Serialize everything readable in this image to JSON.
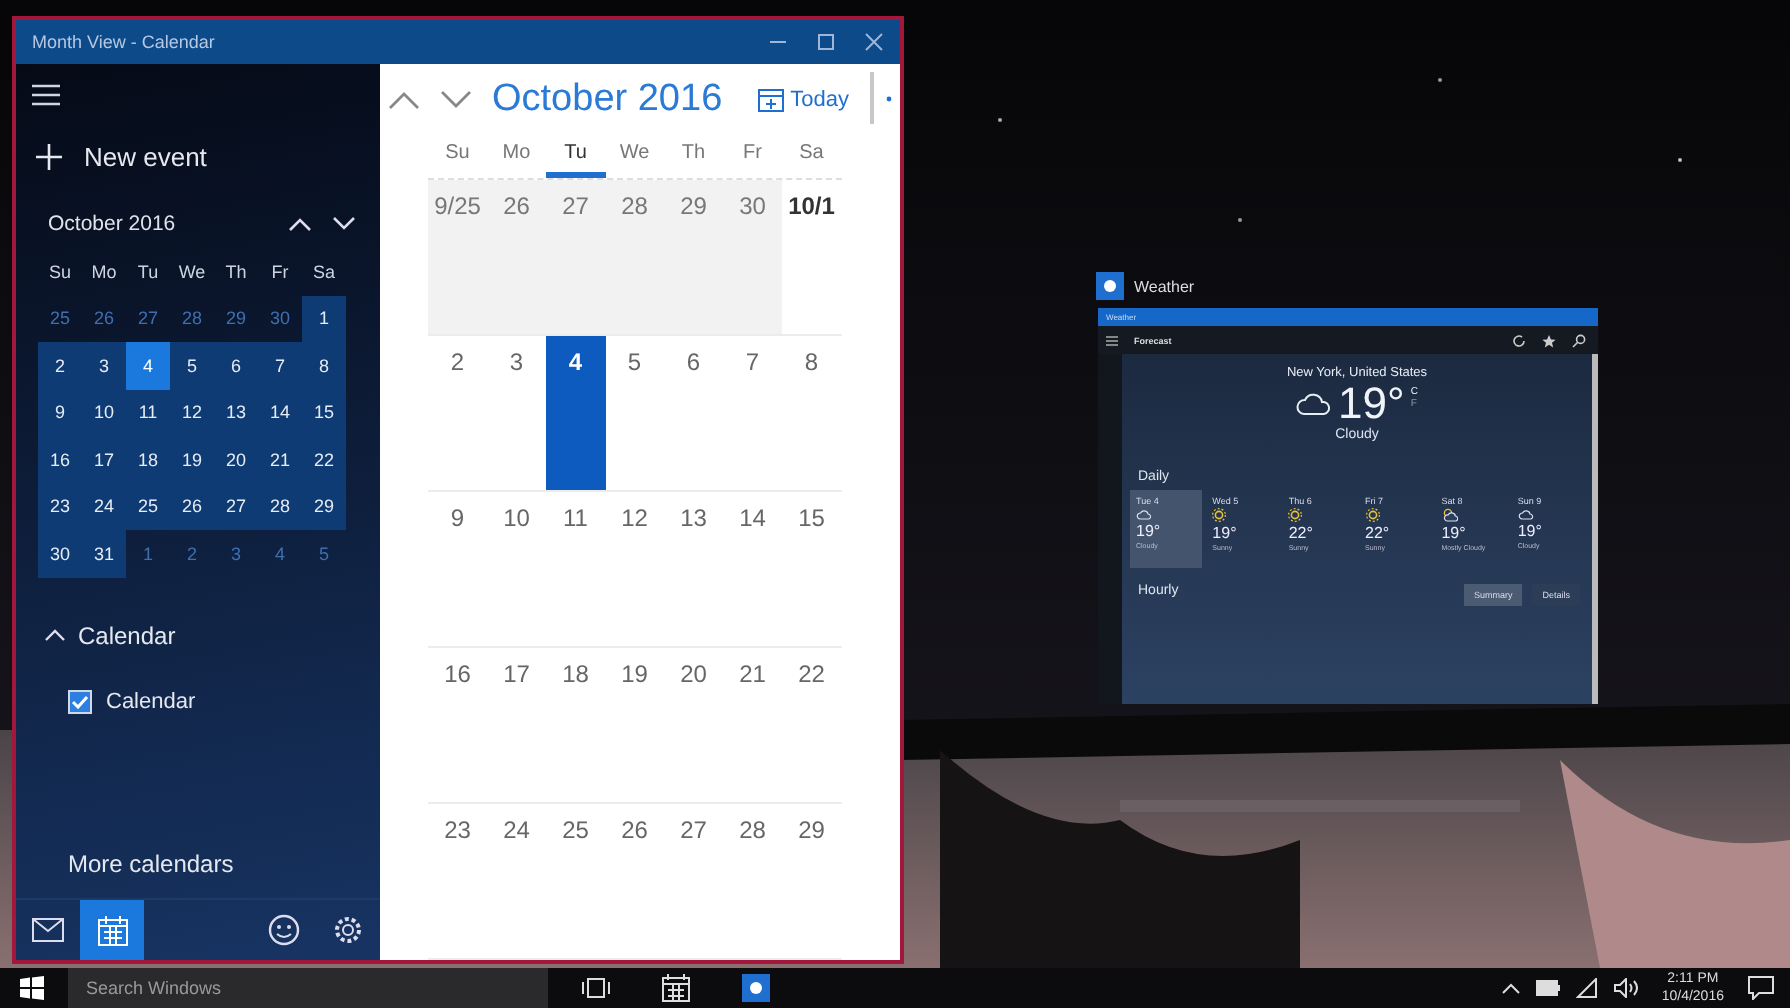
{
  "calendar_window": {
    "title": "Month View - Calendar",
    "sidebar": {
      "new_event": "New event",
      "mini_calendar": {
        "title": "October 2016",
        "weekdays": [
          "Su",
          "Mo",
          "Tu",
          "We",
          "Th",
          "Fr",
          "Sa"
        ],
        "weeks": [
          [
            {
              "day": "25",
              "current_month": false,
              "selected": false
            },
            {
              "day": "26",
              "current_month": false,
              "selected": false
            },
            {
              "day": "27",
              "current_month": false,
              "selected": false
            },
            {
              "day": "28",
              "current_month": false,
              "selected": false
            },
            {
              "day": "29",
              "current_month": false,
              "selected": false
            },
            {
              "day": "30",
              "current_month": false,
              "selected": false
            },
            {
              "day": "1",
              "current_month": true,
              "selected": false
            }
          ],
          [
            {
              "day": "2",
              "current_month": true,
              "selected": false
            },
            {
              "day": "3",
              "current_month": true,
              "selected": false
            },
            {
              "day": "4",
              "current_month": true,
              "selected": true
            },
            {
              "day": "5",
              "current_month": true,
              "selected": false
            },
            {
              "day": "6",
              "current_month": true,
              "selected": false
            },
            {
              "day": "7",
              "current_month": true,
              "selected": false
            },
            {
              "day": "8",
              "current_month": true,
              "selected": false
            }
          ],
          [
            {
              "day": "9",
              "current_month": true,
              "selected": false
            },
            {
              "day": "10",
              "current_month": true,
              "selected": false
            },
            {
              "day": "11",
              "current_month": true,
              "selected": false
            },
            {
              "day": "12",
              "current_month": true,
              "selected": false
            },
            {
              "day": "13",
              "current_month": true,
              "selected": false
            },
            {
              "day": "14",
              "current_month": true,
              "selected": false
            },
            {
              "day": "15",
              "current_month": true,
              "selected": false
            }
          ],
          [
            {
              "day": "16",
              "current_month": true,
              "selected": false
            },
            {
              "day": "17",
              "current_month": true,
              "selected": false
            },
            {
              "day": "18",
              "current_month": true,
              "selected": false
            },
            {
              "day": "19",
              "current_month": true,
              "selected": false
            },
            {
              "day": "20",
              "current_month": true,
              "selected": false
            },
            {
              "day": "21",
              "current_month": true,
              "selected": false
            },
            {
              "day": "22",
              "current_month": true,
              "selected": false
            }
          ],
          [
            {
              "day": "23",
              "current_month": true,
              "selected": false
            },
            {
              "day": "24",
              "current_month": true,
              "selected": false
            },
            {
              "day": "25",
              "current_month": true,
              "selected": false
            },
            {
              "day": "26",
              "current_month": true,
              "selected": false
            },
            {
              "day": "27",
              "current_month": true,
              "selected": false
            },
            {
              "day": "28",
              "current_month": true,
              "selected": false
            },
            {
              "day": "29",
              "current_month": true,
              "selected": false
            }
          ],
          [
            {
              "day": "30",
              "current_month": true,
              "selected": false
            },
            {
              "day": "31",
              "current_month": true,
              "selected": false
            },
            {
              "day": "1",
              "current_month": false,
              "selected": false
            },
            {
              "day": "2",
              "current_month": false,
              "selected": false
            },
            {
              "day": "3",
              "current_month": false,
              "selected": false
            },
            {
              "day": "4",
              "current_month": false,
              "selected": false
            },
            {
              "day": "5",
              "current_month": false,
              "selected": false
            }
          ]
        ]
      },
      "calendars_group": {
        "label": "Calendar",
        "expanded": true,
        "items": [
          {
            "label": "Calendar",
            "checked": true
          }
        ]
      },
      "more_calendars": "More calendars",
      "bottom_nav": [
        {
          "kind": "mail",
          "selected": false
        },
        {
          "kind": "calendar",
          "selected": true
        },
        {
          "kind": "feedback",
          "selected": false
        },
        {
          "kind": "settings",
          "selected": false
        }
      ]
    },
    "month_view": {
      "title": "October 2016",
      "today_button": "Today",
      "weekdays": [
        {
          "label": "Su",
          "selected": false
        },
        {
          "label": "Mo",
          "selected": false
        },
        {
          "label": "Tu",
          "selected": true
        },
        {
          "label": "We",
          "selected": false
        },
        {
          "label": "Th",
          "selected": false
        },
        {
          "label": "Fr",
          "selected": false
        },
        {
          "label": "Sa",
          "selected": false
        }
      ],
      "weeks": [
        [
          {
            "day": "9/25",
            "current_month": false,
            "selected": false,
            "bold": false
          },
          {
            "day": "26",
            "current_month": false,
            "selected": false,
            "bold": false
          },
          {
            "day": "27",
            "current_month": false,
            "selected": false,
            "bold": false
          },
          {
            "day": "28",
            "current_month": false,
            "selected": false,
            "bold": false
          },
          {
            "day": "29",
            "current_month": false,
            "selected": false,
            "bold": false
          },
          {
            "day": "30",
            "current_month": false,
            "selected": false,
            "bold": false
          },
          {
            "day": "10/1",
            "current_month": true,
            "selected": false,
            "bold": true
          }
        ],
        [
          {
            "day": "2",
            "current_month": true,
            "selected": false,
            "bold": false
          },
          {
            "day": "3",
            "current_month": true,
            "selected": false,
            "bold": false
          },
          {
            "day": "4",
            "current_month": true,
            "selected": true,
            "bold": true
          },
          {
            "day": "5",
            "current_month": true,
            "selected": false,
            "bold": false
          },
          {
            "day": "6",
            "current_month": true,
            "selected": false,
            "bold": false
          },
          {
            "day": "7",
            "current_month": true,
            "selected": false,
            "bold": false
          },
          {
            "day": "8",
            "current_month": true,
            "selected": false,
            "bold": false
          }
        ],
        [
          {
            "day": "9",
            "current_month": true,
            "selected": false,
            "bold": false
          },
          {
            "day": "10",
            "current_month": true,
            "selected": false,
            "bold": false
          },
          {
            "day": "11",
            "current_month": true,
            "selected": false,
            "bold": false
          },
          {
            "day": "12",
            "current_month": true,
            "selected": false,
            "bold": false
          },
          {
            "day": "13",
            "current_month": true,
            "selected": false,
            "bold": false
          },
          {
            "day": "14",
            "current_month": true,
            "selected": false,
            "bold": false
          },
          {
            "day": "15",
            "current_month": true,
            "selected": false,
            "bold": false
          }
        ],
        [
          {
            "day": "16",
            "current_month": true,
            "selected": false,
            "bold": false
          },
          {
            "day": "17",
            "current_month": true,
            "selected": false,
            "bold": false
          },
          {
            "day": "18",
            "current_month": true,
            "selected": false,
            "bold": false
          },
          {
            "day": "19",
            "current_month": true,
            "selected": false,
            "bold": false
          },
          {
            "day": "20",
            "current_month": true,
            "selected": false,
            "bold": false
          },
          {
            "day": "21",
            "current_month": true,
            "selected": false,
            "bold": false
          },
          {
            "day": "22",
            "current_month": true,
            "selected": false,
            "bold": false
          }
        ],
        [
          {
            "day": "23",
            "current_month": true,
            "selected": false,
            "bold": false
          },
          {
            "day": "24",
            "current_month": true,
            "selected": false,
            "bold": false
          },
          {
            "day": "25",
            "current_month": true,
            "selected": false,
            "bold": false
          },
          {
            "day": "26",
            "current_month": true,
            "selected": false,
            "bold": false
          },
          {
            "day": "27",
            "current_month": true,
            "selected": false,
            "bold": false
          },
          {
            "day": "28",
            "current_month": true,
            "selected": false,
            "bold": false
          },
          {
            "day": "29",
            "current_month": true,
            "selected": false,
            "bold": false
          }
        ]
      ]
    }
  },
  "weather_window": {
    "label": "Weather",
    "title": "Weather",
    "toolbar_title": "Forecast",
    "location": "New York, United States",
    "temperature": "19°",
    "unit_selected": "C",
    "unit_other": "F",
    "condition": "Cloudy",
    "daily_heading": "Daily",
    "days": [
      {
        "label": "Tue 4",
        "temp": "19°",
        "condition": "Cloudy",
        "kind": "cloud",
        "selected": true
      },
      {
        "label": "Wed 5",
        "temp": "19°",
        "condition": "Sunny",
        "kind": "sun",
        "selected": false
      },
      {
        "label": "Thu 6",
        "temp": "22°",
        "condition": "Sunny",
        "kind": "sun",
        "selected": false
      },
      {
        "label": "Fri 7",
        "temp": "22°",
        "condition": "Sunny",
        "kind": "sun",
        "selected": false
      },
      {
        "label": "Sat 8",
        "temp": "19°",
        "condition": "Mostly Cloudy",
        "kind": "partly",
        "selected": false
      },
      {
        "label": "Sun 9",
        "temp": "19°",
        "condition": "Cloudy",
        "kind": "cloud",
        "selected": false
      }
    ],
    "hourly_heading": "Hourly",
    "buttons": [
      "Summary",
      "Details"
    ]
  },
  "taskbar": {
    "search": {
      "placeholder": "Search Windows"
    },
    "apps": [
      {
        "kind": "task_view"
      },
      {
        "kind": "calendar"
      },
      {
        "kind": "weather"
      }
    ],
    "time": "2:11 PM",
    "date": "10/4/2016"
  }
}
